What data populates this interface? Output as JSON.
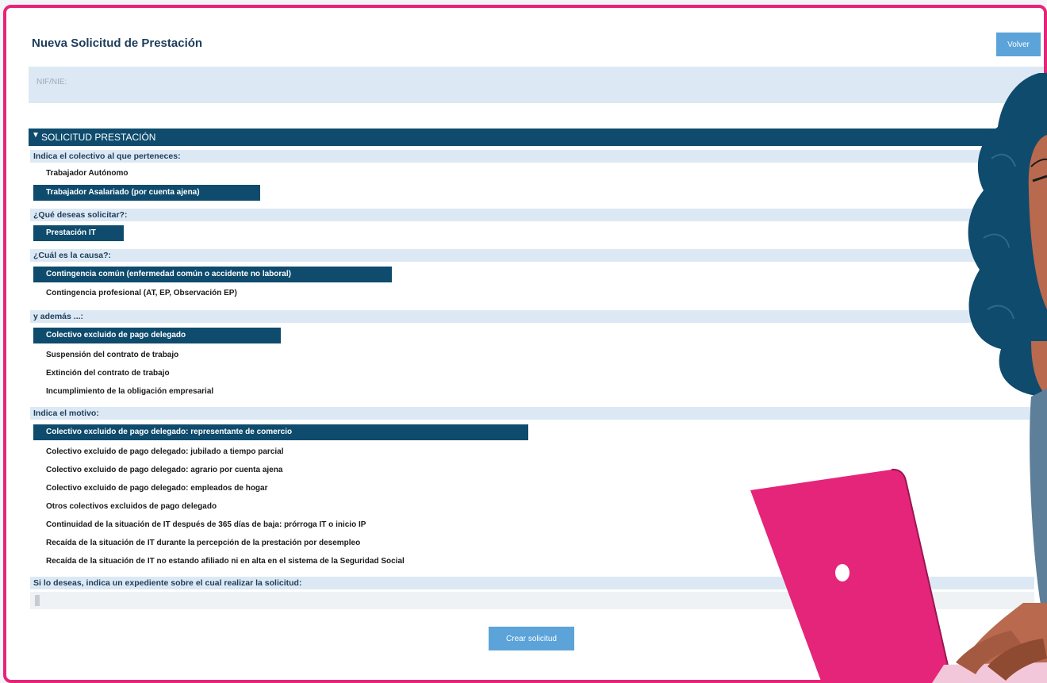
{
  "header": {
    "title": "Nueva Solicitud de Prestación",
    "back_label": "Volver"
  },
  "nif": {
    "placeholder": "NIF/NIE:"
  },
  "section": {
    "title": "SOLICITUD PRESTACIÓN",
    "q1": {
      "label": "Indica el colectivo al que perteneces:",
      "options": [
        "Trabajador Autónomo",
        "Trabajador Asalariado (por cuenta ajena)"
      ]
    },
    "q2": {
      "label": "¿Qué deseas solicitar?:",
      "options": [
        "Prestación IT"
      ]
    },
    "q3": {
      "label": "¿Cuál es la causa?:",
      "options": [
        "Contingencia común (enfermedad común o accidente no laboral)",
        "Contingencia profesional (AT, EP, Observación EP)"
      ]
    },
    "q4": {
      "label": "y además ...:",
      "options": [
        "Colectivo excluido de pago delegado",
        "Suspensión del contrato de trabajo",
        "Extinción del contrato de trabajo",
        "Incumplimiento de la obligación empresarial"
      ]
    },
    "q5": {
      "label": "Indica el motivo:",
      "options": [
        "Colectivo excluido de pago delegado: representante de comercio",
        "Colectivo excluido de pago delegado: jubilado a tiempo parcial",
        "Colectivo excluido de pago delegado: agrario por cuenta ajena",
        "Colectivo excluido de pago delegado: empleados de hogar",
        "Otros colectivos excluidos de pago delegado",
        "Continuidad de la situación de IT después de 365 días de baja: prórroga IT o inicio IP",
        "Recaída de la situación de IT durante la percepción de la prestación por desempleo",
        "Recaída de la situación de IT no estando afiliado ni en alta en el sistema de la Seguridad Social"
      ]
    },
    "q6": {
      "label": "Si lo deseas, indica un expediente sobre el cual realizar la solicitud:"
    }
  },
  "create_label": "Crear solicitud",
  "colors": {
    "frame": "#e5257a",
    "header": "#0e4b6d",
    "label_bg": "#dce9f4",
    "button": "#5ba3d8"
  }
}
